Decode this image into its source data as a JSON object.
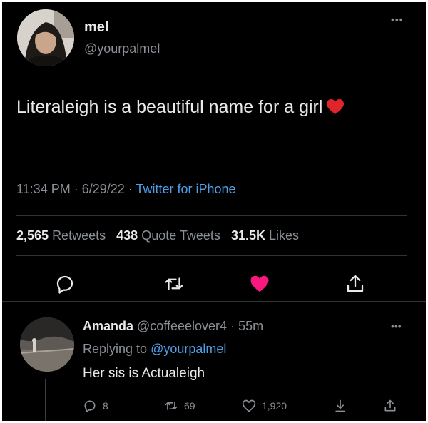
{
  "tweet": {
    "author": {
      "name": "mel",
      "handle": "@yourpalmel"
    },
    "text": "Literaleigh is a beautiful name for a girl",
    "time": "11:34 PM",
    "date": "6/29/22",
    "source": "Twitter for iPhone",
    "stats": {
      "retweets": "2,565",
      "retweets_label": "Retweets",
      "quotes": "438",
      "quotes_label": "Quote Tweets",
      "likes": "31.5K",
      "likes_label": "Likes"
    }
  },
  "reply": {
    "name": "Amanda",
    "handle": "@coffeeelover4",
    "age": "55m",
    "replying_to_label": "Replying to",
    "replying_to": "@yourpalmel",
    "text": "Her sis is Actualeigh",
    "counts": {
      "replies": "8",
      "retweets": "69",
      "likes": "1,920"
    }
  },
  "colors": {
    "background": "#000000",
    "text": "#e7e9ea",
    "muted": "#8b9096",
    "link": "#4f9fe8",
    "liked": "#f91880",
    "heart_emoji": "#e0242c"
  },
  "icons": {
    "reply": "reply-icon",
    "retweet": "retweet-icon",
    "like": "heart-icon",
    "share": "share-icon",
    "more": "more-icon",
    "save": "download-icon"
  }
}
